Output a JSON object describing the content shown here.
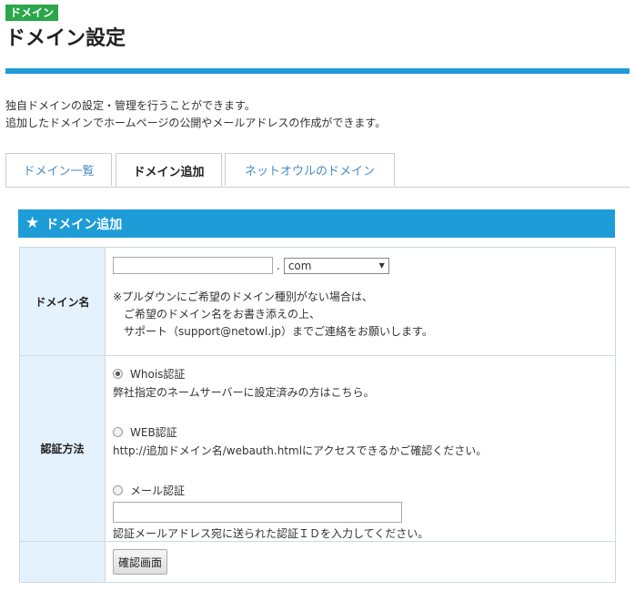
{
  "badge": "ドメイン",
  "page_title": "ドメイン設定",
  "intro": [
    "独自ドメインの設定・管理を行うことができます。",
    "追加したドメインでホームページの公開やメールアドレスの作成ができます。"
  ],
  "tabs": [
    {
      "label": "ドメイン一覧",
      "active": false
    },
    {
      "label": "ドメイン追加",
      "active": true
    },
    {
      "label": "ネットオウルのドメイン",
      "active": false
    }
  ],
  "section": {
    "icon": "star-icon",
    "title": "ドメイン追加"
  },
  "domain_row": {
    "label": "ドメイン名",
    "input_value": "",
    "separator": ".",
    "tld_selected": "com",
    "notes": [
      "※プルダウンにご希望のドメイン種別がない場合は、",
      "ご希望のドメイン名をお書き添えの上、",
      "サポート（support@netowl.jp）までご連絡をお願いします。"
    ]
  },
  "auth_row": {
    "label": "認証方法",
    "options": [
      {
        "label": "Whois認証",
        "checked": true,
        "desc": "弊社指定のネームサーバーに設定済みの方はこちら。"
      },
      {
        "label": "WEB認証",
        "checked": false,
        "desc": "http://追加ドメイン名/webauth.htmlにアクセスできるかご確認ください。"
      },
      {
        "label": "メール認証",
        "checked": false,
        "desc": "認証メールアドレス宛に送られた認証ＩＤを入力してください。"
      }
    ],
    "mail_input_value": ""
  },
  "submit": {
    "label": "確認画面"
  },
  "colors": {
    "accent_blue": "#1e9cd8",
    "badge_green": "#2aa74a",
    "header_cell_bg": "#e3f2fc",
    "tab_link": "#4a8dc4"
  }
}
